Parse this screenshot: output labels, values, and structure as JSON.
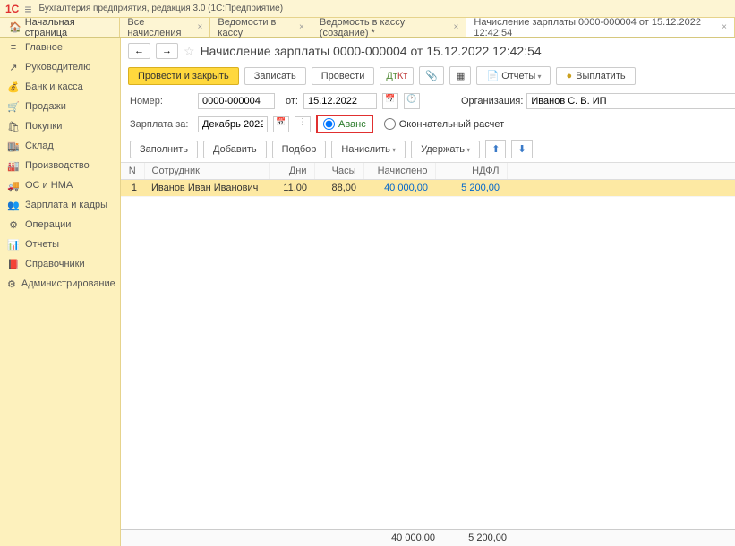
{
  "app": {
    "title": "Бухгалтерия предприятия, редакция 3.0  (1С:Предприятие)",
    "logo": "1C"
  },
  "tabs": {
    "home": "Начальная страница",
    "items": [
      {
        "label": "Все начисления"
      },
      {
        "label": "Ведомости в кассу"
      },
      {
        "label": "Ведомость в кассу (создание) *"
      },
      {
        "label": "Начисление зарплаты 0000-000004 от 15.12.2022 12:42:54",
        "active": true
      }
    ]
  },
  "sidebar": [
    {
      "icon": "≡",
      "label": "Главное"
    },
    {
      "icon": "↗",
      "label": "Руководителю"
    },
    {
      "icon": "💰",
      "label": "Банк и касса"
    },
    {
      "icon": "🛒",
      "label": "Продажи"
    },
    {
      "icon": "🛍",
      "label": "Покупки"
    },
    {
      "icon": "🏬",
      "label": "Склад"
    },
    {
      "icon": "🏭",
      "label": "Производство"
    },
    {
      "icon": "🚚",
      "label": "ОС и НМА"
    },
    {
      "icon": "👥",
      "label": "Зарплата и кадры"
    },
    {
      "icon": "⚙",
      "label": "Операции"
    },
    {
      "icon": "📊",
      "label": "Отчеты"
    },
    {
      "icon": "📕",
      "label": "Справочники"
    },
    {
      "icon": "⚙",
      "label": "Администрирование"
    }
  ],
  "doc": {
    "title": "Начисление зарплаты 0000-000004 от 15.12.2022 12:42:54",
    "btn_provesti_zakryt": "Провести и закрыть",
    "btn_zapisat": "Записать",
    "btn_provesti": "Провести",
    "btn_otchety": "Отчеты",
    "btn_vyplatit": "Выплатить",
    "label_nomer": "Номер:",
    "nomer": "0000-000004",
    "label_ot": "от:",
    "ot": "15.12.2022",
    "label_org": "Организация:",
    "org": "Иванов С. В. ИП",
    "label_period": "Зарплата за:",
    "period": "Декабрь 2022",
    "radio_avans": "Аванс",
    "radio_final": "Окончательный расчет",
    "btn_zapolnit": "Заполнить",
    "btn_dobavit": "Добавить",
    "btn_podbor": "Подбор",
    "btn_nachislit": "Начислить",
    "btn_uderzhat": "Удержать"
  },
  "table": {
    "headers": {
      "n": "N",
      "emp": "Сотрудник",
      "days": "Дни",
      "hours": "Часы",
      "accrued": "Начислено",
      "ndfl": "НДФЛ"
    },
    "rows": [
      {
        "n": "1",
        "emp": "Иванов Иван Иванович",
        "days": "11,00",
        "hours": "88,00",
        "accrued": "40 000,00",
        "ndfl": "5 200,00"
      }
    ],
    "footer": {
      "accrued": "40 000,00",
      "ndfl": "5 200,00"
    }
  }
}
